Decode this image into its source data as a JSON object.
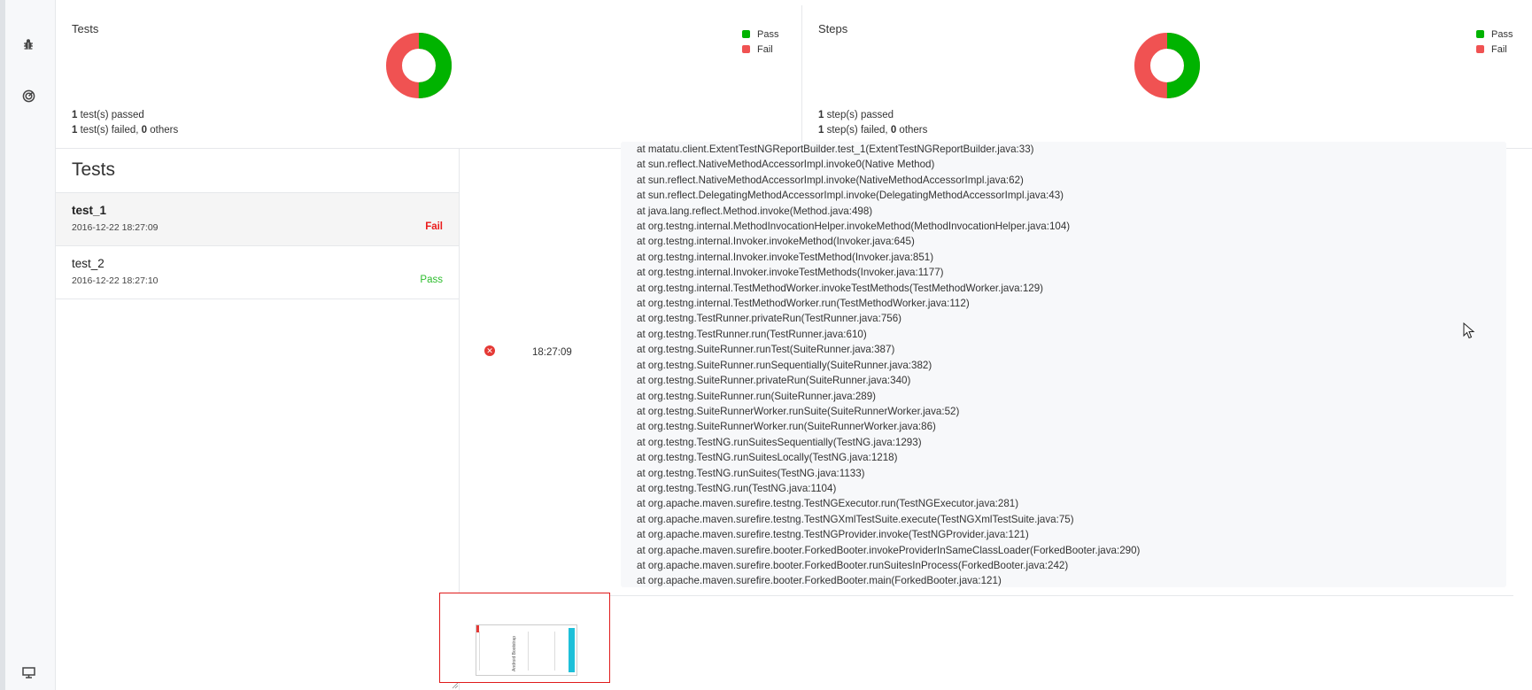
{
  "rail": {
    "icons": [
      "bug-icon",
      "dashboard-icon",
      "monitor-icon"
    ]
  },
  "dashboard": {
    "tests": {
      "title": "Tests",
      "legend": [
        {
          "label": "Pass",
          "color": "#00b300"
        },
        {
          "label": "Fail",
          "color": "#f05252"
        }
      ],
      "pass_fraction": 0.5,
      "summary_passed_count": "1",
      "summary_passed_text": " test(s) passed",
      "summary_failed_count": "1",
      "summary_failed_text": " test(s) failed, ",
      "summary_others_count": "0",
      "summary_others_text": " others"
    },
    "steps": {
      "title": "Steps",
      "legend": [
        {
          "label": "Pass",
          "color": "#00b300"
        },
        {
          "label": "Fail",
          "color": "#f05252"
        }
      ],
      "pass_fraction": 0.5,
      "summary_passed_count": "1",
      "summary_passed_text": " step(s) passed",
      "summary_failed_count": "1",
      "summary_failed_text": " step(s) failed, ",
      "summary_others_count": "0",
      "summary_others_text": " others"
    }
  },
  "test_list": {
    "heading": "Tests",
    "items": [
      {
        "name": "test_1",
        "time": "2016-12-22 18:27:09",
        "status": "Fail"
      },
      {
        "name": "test_2",
        "time": "2016-12-22 18:27:10",
        "status": "Pass"
      }
    ]
  },
  "log": {
    "status": "fail",
    "time": "18:27:09",
    "stack": [
      "at matatu.client.ExtentTestNGReportBuilder.test_1(ExtentTestNGReportBuilder.java:33)",
      "at sun.reflect.NativeMethodAccessorImpl.invoke0(Native Method)",
      "at sun.reflect.NativeMethodAccessorImpl.invoke(NativeMethodAccessorImpl.java:62)",
      "at sun.reflect.DelegatingMethodAccessorImpl.invoke(DelegatingMethodAccessorImpl.java:43)",
      "at java.lang.reflect.Method.invoke(Method.java:498)",
      "at org.testng.internal.MethodInvocationHelper.invokeMethod(MethodInvocationHelper.java:104)",
      "at org.testng.internal.Invoker.invokeMethod(Invoker.java:645)",
      "at org.testng.internal.Invoker.invokeTestMethod(Invoker.java:851)",
      "at org.testng.internal.Invoker.invokeTestMethods(Invoker.java:1177)",
      "at org.testng.internal.TestMethodWorker.invokeTestMethods(TestMethodWorker.java:129)",
      "at org.testng.internal.TestMethodWorker.run(TestMethodWorker.java:112)",
      "at org.testng.TestRunner.privateRun(TestRunner.java:756)",
      "at org.testng.TestRunner.run(TestRunner.java:610)",
      "at org.testng.SuiteRunner.runTest(SuiteRunner.java:387)",
      "at org.testng.SuiteRunner.runSequentially(SuiteRunner.java:382)",
      "at org.testng.SuiteRunner.privateRun(SuiteRunner.java:340)",
      "at org.testng.SuiteRunner.run(SuiteRunner.java:289)",
      "at org.testng.SuiteRunnerWorker.runSuite(SuiteRunnerWorker.java:52)",
      "at org.testng.SuiteRunnerWorker.run(SuiteRunnerWorker.java:86)",
      "at org.testng.TestNG.runSuitesSequentially(TestNG.java:1293)",
      "at org.testng.TestNG.runSuitesLocally(TestNG.java:1218)",
      "at org.testng.TestNG.runSuites(TestNG.java:1133)",
      "at org.testng.TestNG.run(TestNG.java:1104)",
      "at org.apache.maven.surefire.testng.TestNGExecutor.run(TestNGExecutor.java:281)",
      "at org.apache.maven.surefire.testng.TestNGXmlTestSuite.execute(TestNGXmlTestSuite.java:75)",
      "at org.apache.maven.surefire.testng.TestNGProvider.invoke(TestNGProvider.java:121)",
      "at org.apache.maven.surefire.booter.ForkedBooter.invokeProviderInSameClassLoader(ForkedBooter.java:290)",
      "at org.apache.maven.surefire.booter.ForkedBooter.runSuitesInProcess(ForkedBooter.java:242)",
      "at org.apache.maven.surefire.booter.ForkedBooter.main(ForkedBooter.java:121)"
    ],
    "screenshot_thumbnail_text": "Android Bootstrap"
  },
  "colors": {
    "pass": "#00b300",
    "fail": "#f05252",
    "fail_text": "#eb1b1b",
    "pass_text": "#2ebd2e",
    "thumb_border": "#e01b1b"
  }
}
